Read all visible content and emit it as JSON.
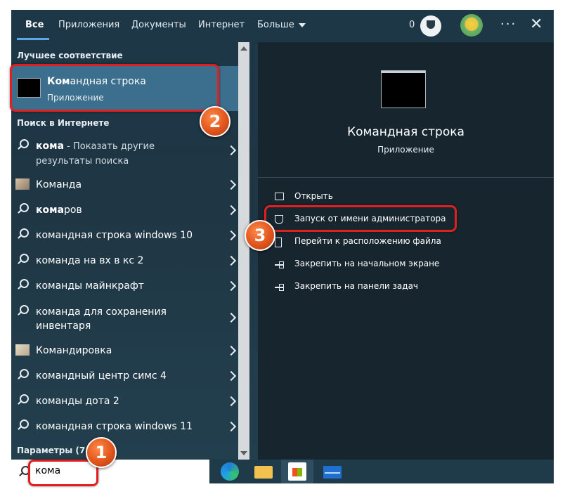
{
  "tabs": [
    {
      "label": "Все",
      "active": true
    },
    {
      "label": "Приложения"
    },
    {
      "label": "Документы"
    },
    {
      "label": "Интернет"
    },
    {
      "label": "Больше"
    }
  ],
  "header": {
    "points": "0"
  },
  "left": {
    "best_match_heading": "Лучшее соответствие",
    "best_match": {
      "title_bold": "Ком",
      "title_rest": "андная строка",
      "subtitle": "Приложение"
    },
    "web_heading": "Поиск в Интернете",
    "results": [
      {
        "icon": "search-icon",
        "bold": "кома",
        "rest": "",
        "extra": " - Показать другие результаты поиска"
      },
      {
        "icon": "image-thumb",
        "bold": "",
        "rest": "Команда"
      },
      {
        "icon": "search-icon",
        "bold": "кома",
        "rest": "ров"
      },
      {
        "icon": "search-icon",
        "bold": "",
        "rest": "командная строка windows 10"
      },
      {
        "icon": "search-icon",
        "bold": "",
        "rest": "команда на вх в кс 2"
      },
      {
        "icon": "search-icon",
        "bold": "",
        "rest": "команды майнкрафт"
      },
      {
        "icon": "search-icon",
        "bold": "",
        "rest": "команда для сохранения инвентаря"
      },
      {
        "icon": "image-thumb",
        "bold": "",
        "rest": "Командировка"
      },
      {
        "icon": "search-icon",
        "bold": "",
        "rest": "командный центр симс 4"
      },
      {
        "icon": "search-icon",
        "bold": "",
        "rest": "команды дота 2"
      },
      {
        "icon": "search-icon",
        "bold": "",
        "rest": "командная строка windows 11"
      }
    ],
    "settings_heading": "Параметры (7+)"
  },
  "right": {
    "title": "Командная строка",
    "subtitle": "Приложение",
    "actions": [
      {
        "icon": "open-icon",
        "label": "Открыть"
      },
      {
        "icon": "shield-icon",
        "label": "Запуск от имени администратора"
      },
      {
        "icon": "folder-location-icon",
        "label": "Перейти к расположению файла"
      },
      {
        "icon": "pin-icon",
        "label": "Закрепить на начальном экране"
      },
      {
        "icon": "pin-icon",
        "label": "Закрепить на панели задач"
      }
    ]
  },
  "search": {
    "value": "кома"
  },
  "taskbar": {
    "apps": [
      "edge-icon",
      "file-explorer-icon",
      "store-icon",
      "mail-icon"
    ]
  },
  "annotations": {
    "step1": "1",
    "step2": "2",
    "step3": "3"
  },
  "colors": {
    "selected": "#3c6e8d",
    "highlight": "#e02020",
    "badge": "#e0551c"
  }
}
